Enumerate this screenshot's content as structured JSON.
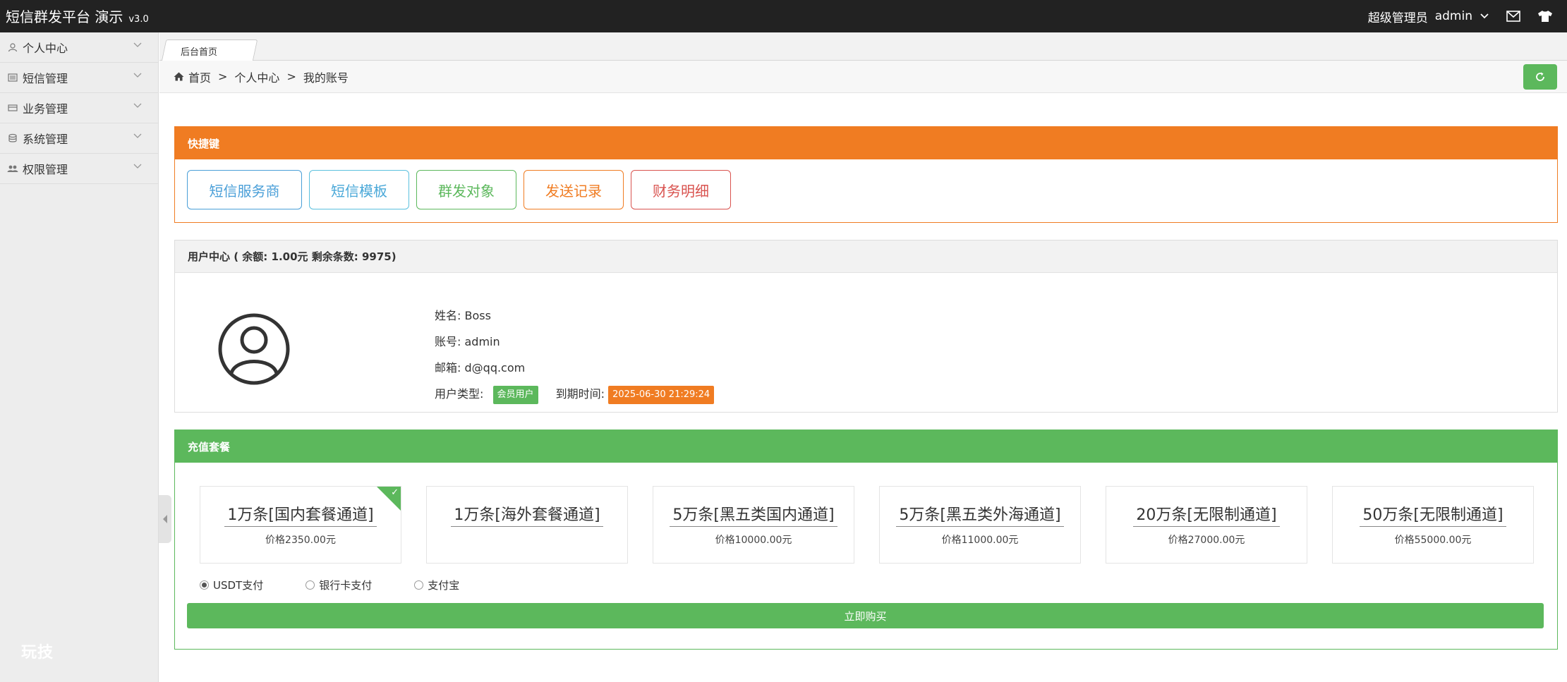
{
  "app": {
    "title": "短信群发平台 演示",
    "version": "v3.0"
  },
  "topbar": {
    "role": "超级管理员",
    "username": "admin"
  },
  "sidebar": {
    "items": [
      {
        "label": "个人中心",
        "icon": "user-icon"
      },
      {
        "label": "短信管理",
        "icon": "list-icon"
      },
      {
        "label": "业务管理",
        "icon": "card-icon"
      },
      {
        "label": "系统管理",
        "icon": "database-icon"
      },
      {
        "label": "权限管理",
        "icon": "users-icon"
      }
    ],
    "footer": "玩技"
  },
  "tabs": [
    {
      "label": "后台首页"
    }
  ],
  "breadcrumb": {
    "home": "首页",
    "sep": ">",
    "level1": "个人中心",
    "level2": "我的账号"
  },
  "quick": {
    "title": "快捷键",
    "buttons": [
      {
        "label": "短信服务商",
        "color": "#4a9fd8"
      },
      {
        "label": "短信模板",
        "color": "#5bc0de"
      },
      {
        "label": "群发对象",
        "color": "#5cb85c"
      },
      {
        "label": "发送记录",
        "color": "#f07c22"
      },
      {
        "label": "财务明细",
        "color": "#d9534f"
      }
    ]
  },
  "user_center": {
    "title": "用户中心 ( 余额: 1.00元 剩余条数: 9975)",
    "name_label": "姓名:",
    "name": "Boss",
    "account_label": "账号:",
    "account": "admin",
    "email_label": "邮箱:",
    "email": "d@qq.com",
    "type_label": "用户类型:",
    "type": "会员用户",
    "expire_label": "到期时间:",
    "expire": "2025-06-30 21:29:24",
    "type_color": "#5cb85c",
    "expire_color": "#f07c22"
  },
  "recharge": {
    "title": "充值套餐",
    "packages": [
      {
        "name": "1万条[国内套餐通道]",
        "price": "价格2350.00元",
        "selected": true
      },
      {
        "name": "1万条[海外套餐通道]",
        "price": "",
        "selected": false
      },
      {
        "name": "5万条[黑五类国内通道]",
        "price": "价格10000.00元",
        "selected": false
      },
      {
        "name": "5万条[黑五类外海通道]",
        "price": "价格11000.00元",
        "selected": false
      },
      {
        "name": "20万条[无限制通道]",
        "price": "价格27000.00元",
        "selected": false
      },
      {
        "name": "50万条[无限制通道]",
        "price": "价格55000.00元",
        "selected": false
      }
    ],
    "payments": [
      {
        "label": "USDT支付",
        "checked": true
      },
      {
        "label": "银行卡支付",
        "checked": false
      },
      {
        "label": "支付宝",
        "checked": false
      }
    ],
    "buy_label": "立即购买"
  }
}
